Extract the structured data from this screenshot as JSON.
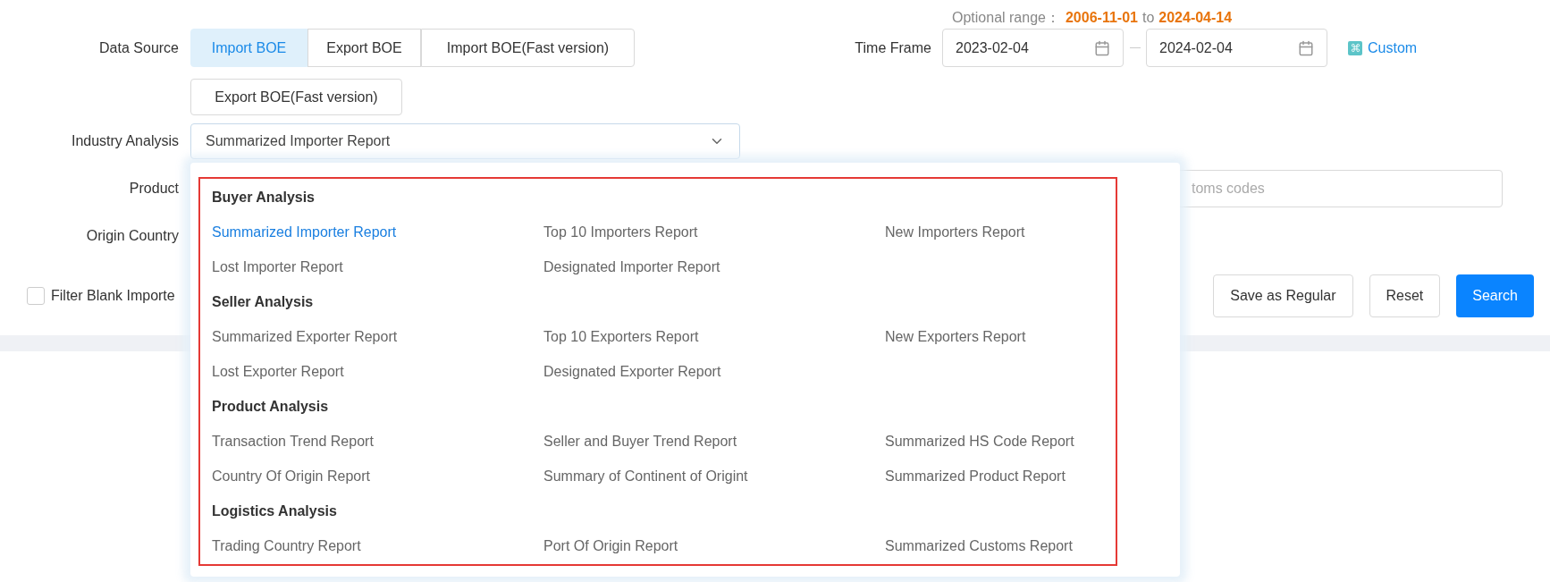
{
  "optional_range": {
    "label": "Optional range：",
    "start": "2006-11-01",
    "joiner": "to",
    "end": "2024-04-14"
  },
  "data_source": {
    "label": "Data Source",
    "options": [
      {
        "label": "Import BOE",
        "selected": true
      },
      {
        "label": "Export BOE",
        "selected": false
      },
      {
        "label": "Import BOE(Fast version)",
        "selected": false
      },
      {
        "label": "Export BOE(Fast version)",
        "selected": false
      }
    ]
  },
  "time_frame": {
    "label": "Time Frame",
    "start": "2023-02-04",
    "end": "2024-02-04",
    "custom_link": "Custom"
  },
  "industry_analysis": {
    "label": "Industry Analysis",
    "value": "Summarized Importer Report",
    "expanded": true
  },
  "product": {
    "label": "Product",
    "placeholder": "toms codes"
  },
  "origin_country": {
    "label": "Origin Country"
  },
  "filter_blank": {
    "label": "Filter Blank Importe",
    "checked": false
  },
  "actions": [
    {
      "label": "Save as Regular",
      "kind": "default"
    },
    {
      "label": "Reset",
      "kind": "default"
    },
    {
      "label": "Search",
      "kind": "primary"
    }
  ],
  "dropdown": {
    "groups": [
      {
        "title": "Buyer Analysis",
        "items": [
          {
            "label": "Summarized Importer Report",
            "selected": true
          },
          {
            "label": "Top 10 Importers Report",
            "selected": false
          },
          {
            "label": "New Importers Report",
            "selected": false
          },
          {
            "label": "Lost Importer Report",
            "selected": false
          },
          {
            "label": "Designated Importer Report",
            "selected": false
          }
        ]
      },
      {
        "title": "Seller Analysis",
        "items": [
          {
            "label": "Summarized Exporter Report",
            "selected": false
          },
          {
            "label": "Top 10 Exporters Report",
            "selected": false
          },
          {
            "label": "New Exporters Report",
            "selected": false
          },
          {
            "label": "Lost Exporter Report",
            "selected": false
          },
          {
            "label": "Designated Exporter Report",
            "selected": false
          }
        ]
      },
      {
        "title": "Product Analysis",
        "items": [
          {
            "label": "Transaction Trend Report",
            "selected": false
          },
          {
            "label": "Seller and Buyer Trend Report",
            "selected": false
          },
          {
            "label": "Summarized HS Code Report",
            "selected": false
          },
          {
            "label": "Country Of Origin Report",
            "selected": false
          },
          {
            "label": "Summary of Continent of Origint",
            "selected": false
          },
          {
            "label": "Summarized Product Report",
            "selected": false
          }
        ]
      },
      {
        "title": "Logistics Analysis",
        "items": [
          {
            "label": "Trading Country Report",
            "selected": false
          },
          {
            "label": "Port Of Origin Report",
            "selected": false
          },
          {
            "label": "Summarized Customs Report",
            "selected": false
          }
        ]
      }
    ]
  }
}
